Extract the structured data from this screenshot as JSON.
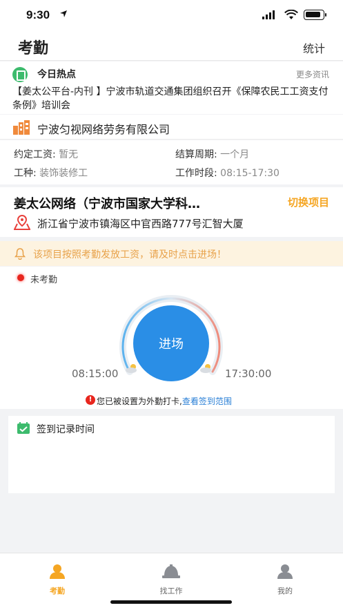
{
  "status_bar": {
    "time": "9:30"
  },
  "nav": {
    "title": "考勤",
    "right_action": "统计"
  },
  "news": {
    "title": "今日热点",
    "more": "更多资讯",
    "headline": "【姜太公平台-内刊 】宁波市轨道交通集团组织召开《保障农民工工资支付条例》培训会"
  },
  "company": {
    "name": "宁波匀视网络劳务有限公司"
  },
  "job_info": {
    "wage_label": "约定工资:",
    "wage_value": "暂无",
    "cycle_label": "结算周期:",
    "cycle_value": "一个月",
    "type_label": "工种:",
    "type_value": "装饰装修工",
    "hours_label": "工作时段:",
    "hours_value": "08:15-17:30"
  },
  "project": {
    "name": "姜太公网络（宁波市国家大学科…",
    "switch_label": "切换项目",
    "address": "浙江省宁波市镇海区中官西路777号汇智大厦"
  },
  "notice": {
    "text": "该项目按照考勤发放工资，请及时点击进场！"
  },
  "attendance": {
    "status": "未考勤",
    "punch_label": "进场",
    "start_time": "08:15:00",
    "end_time": "17:30:00",
    "warning_text": "您已被设置为外勤打卡,",
    "warning_link": "查看签到范围"
  },
  "record": {
    "title": "签到记录时间"
  },
  "tabs": [
    {
      "label": "考勤",
      "active": true
    },
    {
      "label": "找工作",
      "active": false
    },
    {
      "label": "我的",
      "active": false
    }
  ],
  "colors": {
    "accent": "#f5a623",
    "primary_blue": "#2a8ee6",
    "notice_bg": "#fdf3e0",
    "status_red": "#e8261e"
  }
}
